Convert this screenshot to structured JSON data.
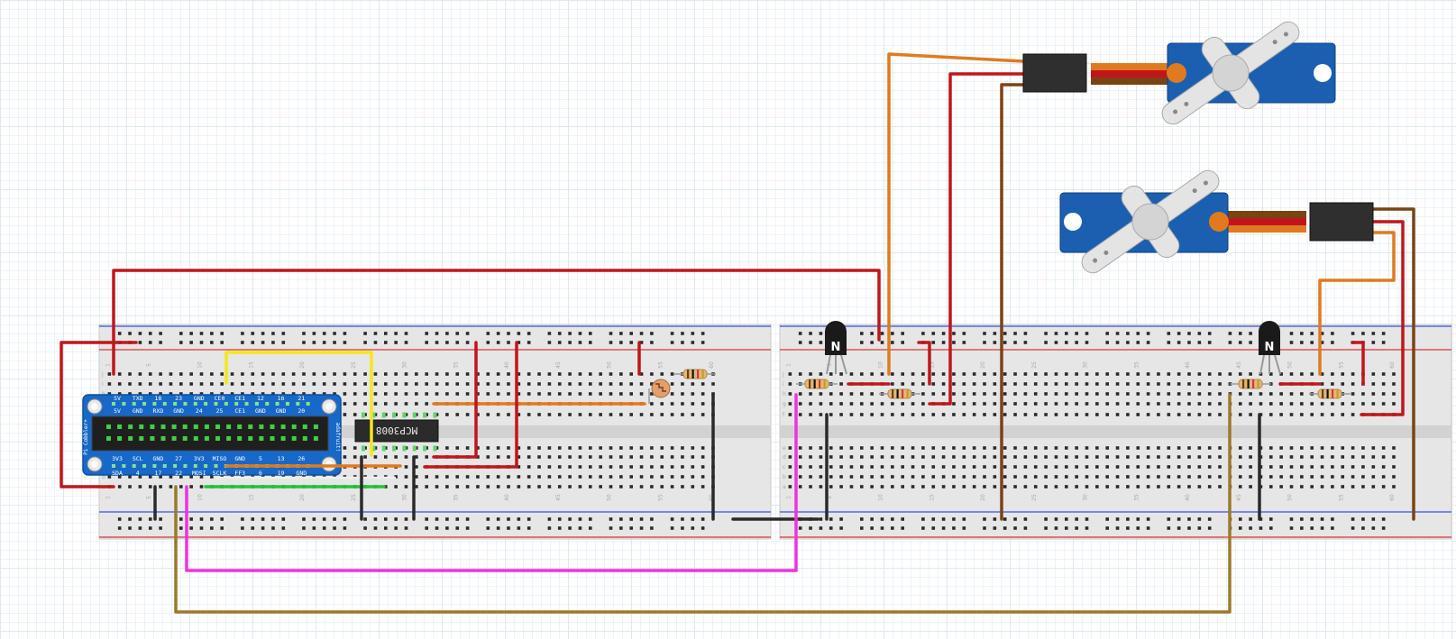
{
  "chip": {
    "label": "MCP3008"
  },
  "transistors": [
    {
      "mark": "N"
    },
    {
      "mark": "N"
    }
  ],
  "cobbler": {
    "top_row1": [
      "5V",
      "TXD",
      "18",
      "23",
      "GND",
      "CE0",
      "CE1",
      "12",
      "16",
      "21"
    ],
    "top_row2": [
      "5V",
      "GND",
      "RXD",
      "GND",
      "24",
      "25",
      "CE1",
      "GND",
      "GND",
      "20"
    ],
    "bottom_row1": [
      "3V3",
      "SCL",
      "GND",
      "27",
      "3V3",
      "MISO",
      "GND",
      "5",
      "13",
      "26"
    ],
    "bottom_row2": [
      "SDA",
      "4",
      "17",
      "22",
      "MOSI",
      "SCLK",
      "FF3",
      "6",
      "19",
      "GND"
    ],
    "side_left": "Pi Cobbler+",
    "side_right": "adafruit!"
  },
  "breadboard_numbers": [
    "1",
    "5",
    "10",
    "15",
    "20",
    "25",
    "30",
    "35",
    "40",
    "45",
    "50",
    "55",
    "60"
  ],
  "row_letters": [
    "a",
    "b",
    "c",
    "d",
    "e",
    "f",
    "g",
    "h",
    "i",
    "j"
  ],
  "colors": {
    "red": "#c0161b",
    "black": "#2a2a2a",
    "orange": "#e07a1f",
    "brown": "#7a4314",
    "yellow": "#f5e61b",
    "green": "#1fc43a",
    "magenta": "#ee33dd",
    "olive": "#9c7a2a",
    "cobbler": "#1769c9",
    "servo": "#1a5fb0"
  }
}
